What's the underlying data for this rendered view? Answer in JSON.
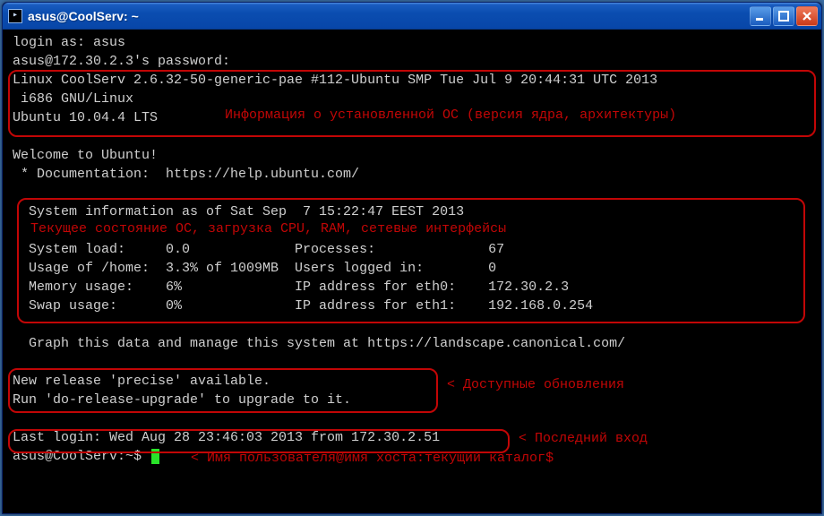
{
  "window": {
    "title": "asus@CoolServ: ~"
  },
  "term": {
    "line1": "login as: asus",
    "line2": "asus@172.30.2.3's password:",
    "line3": "Linux CoolServ 2.6.32-50-generic-pae #112-Ubuntu SMP Tue Jul 9 20:44:31 UTC 2013",
    "line4": " i686 GNU/Linux",
    "line5": "Ubuntu 10.04.4 LTS",
    "blank1": "",
    "line6": "Welcome to Ubuntu!",
    "line7": " * Documentation:  https://help.ubuntu.com/",
    "blank2": "",
    "line8": "  System information as of Sat Sep  7 15:22:47 EEST 2013",
    "blank3": "",
    "line9": "  System load:     0.0             Processes:              67",
    "line10": "  Usage of /home:  3.3% of 1009MB  Users logged in:        0",
    "line11": "  Memory usage:    6%              IP address for eth0:    172.30.2.3",
    "line12": "  Swap usage:      0%              IP address for eth1:    192.168.0.254",
    "blank4": "",
    "line13": "  Graph this data and manage this system at https://landscape.canonical.com/",
    "blank5": "",
    "line14": "New release 'precise' available.",
    "line15": "Run 'do-release-upgrade' to upgrade to it.",
    "blank6": "",
    "line16": "Last login: Wed Aug 28 23:46:03 2013 from 172.30.2.51",
    "prompt": "asus@CoolServ:~$ "
  },
  "annotations": {
    "a1": "Информация о установленной ОС (версия ядра, архитектуры)",
    "a2": "Текущее состояние ОС, загрузка CPU, RAM, сетевые интерфейсы",
    "a3": "< Доступные обновления",
    "a4": "< Последний вход",
    "a5": "< Имя пользователя@имя хоста:текущий каталог$"
  }
}
